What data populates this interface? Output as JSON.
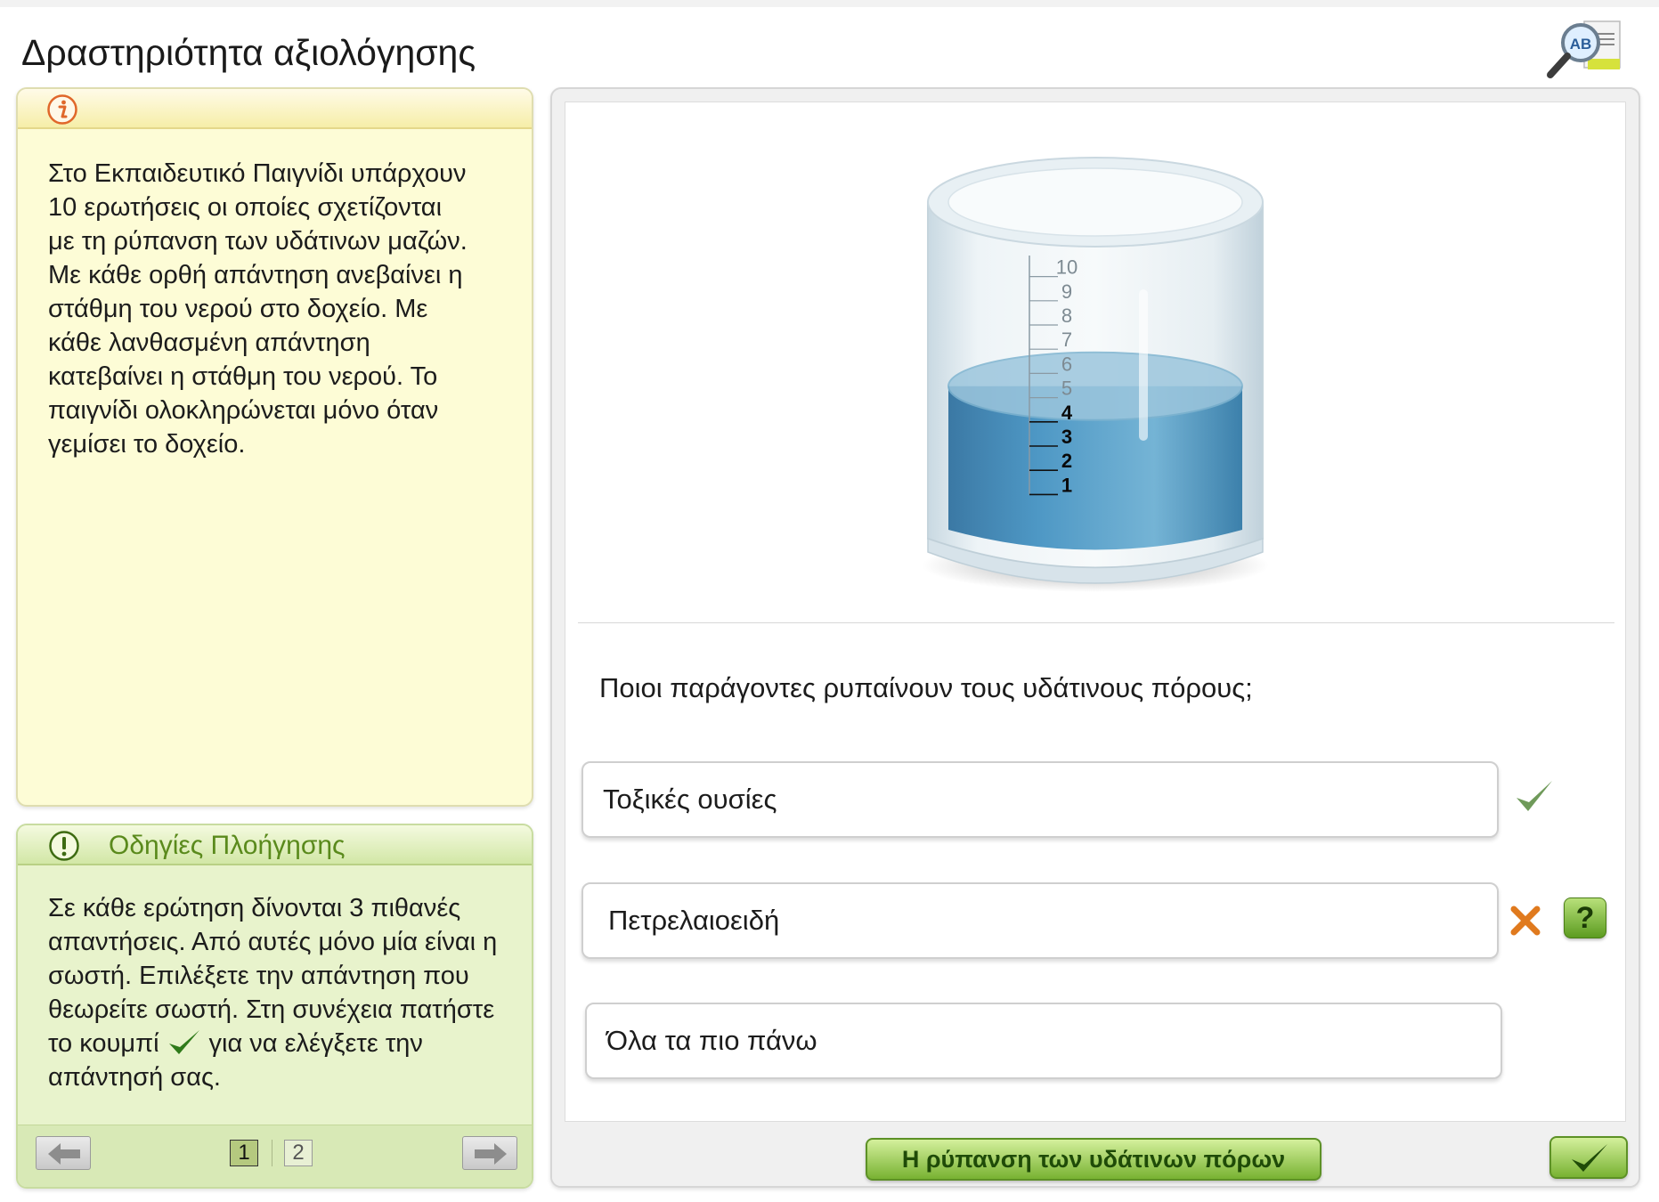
{
  "app": {
    "title": "Δραστηριότητα αξιολόγησης",
    "top_icon_text": "AB"
  },
  "info_panel": {
    "icon": "info-icon",
    "text": "Στο Εκπαιδευτικό Παιγνίδι υπάρχουν\n10 ερωτήσεις οι οποίες σχετίζονται\nμε τη ρύπανση των υδάτινων μαζών.\nΜε κάθε ορθή απάντηση ανεβαίνει η\nστάθμη του νερού στο δοχείο.  Με\nκάθε λανθασμένη απάντηση\nκατεβαίνει η στάθμη του νερού.  Το\nπαιγνίδι ολοκληρώνεται μόνο όταν\nγεμίσει το δοχείο."
  },
  "nav_panel": {
    "title": "Οδηγίες Πλοήγησης",
    "text_before": "Σε κάθε ερώτηση δίνονται 3 πιθανές απαντήσεις. Από αυτές μόνο μία είναι η σωστή. Επιλέξετε την απάντηση που θεωρείτε σωστή. Στη συνέχεια πατήστε το κουμπί",
    "text_after": "για να ελέγξετε την απάντησή σας.",
    "pages": [
      "1",
      "2"
    ],
    "current_page": "1"
  },
  "beaker": {
    "scale_labels": [
      "10",
      "9",
      "8",
      "7",
      "6",
      "5",
      "4",
      "3",
      "2",
      "1"
    ],
    "scale_max": 10,
    "water_level": 4
  },
  "quiz": {
    "question": "Ποιοι παράγοντες ρυπαίνουν τους υδάτινους πόρους;",
    "answers": [
      {
        "label": "Τοξικές ουσίες",
        "status": "correct"
      },
      {
        "label": "Πετρελαιοειδή",
        "status": "incorrect"
      },
      {
        "label": "Όλα τα πιο πάνω",
        "status": "none"
      }
    ],
    "help_label": "?"
  },
  "bottom_bar": {
    "topic_label": "Η ρύπανση των υδάτινων πόρων"
  },
  "colors": {
    "accent_green": "#5d9126",
    "correct_check": "#6f9a5a",
    "incorrect_x": "#e07a1e",
    "water": "#3f8fc0"
  }
}
